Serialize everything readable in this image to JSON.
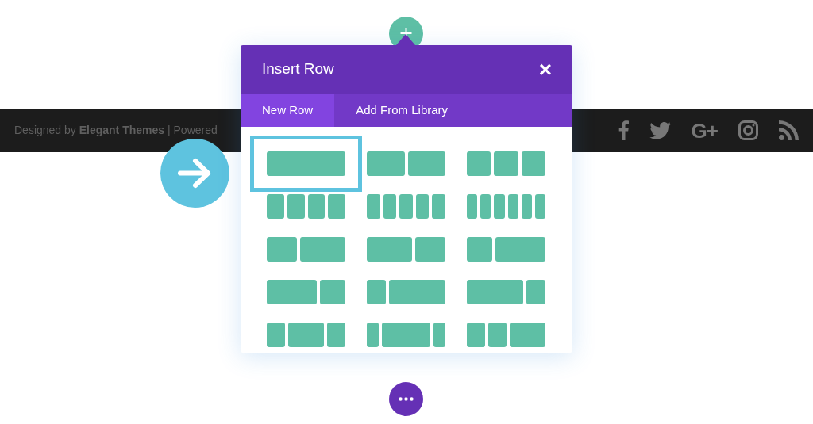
{
  "footer": {
    "credit": "Designed by **Elegant Themes** | Powered",
    "social": [
      {
        "kind": "facebook"
      },
      {
        "kind": "twitter"
      },
      {
        "kind": "gplus",
        "label": "G+"
      },
      {
        "kind": "instagram"
      },
      {
        "kind": "rss"
      }
    ]
  },
  "dialog": {
    "title": "Insert Row",
    "close": "×",
    "tabs": [
      {
        "label": "New Row",
        "selected": true
      },
      {
        "label": "Add From Library",
        "selected": false
      }
    ],
    "layouts": [
      {
        "kind": "full",
        "selected": true
      },
      {
        "kind": "halves",
        "selected": false
      },
      {
        "kind": "thirds",
        "selected": false
      },
      {
        "kind": "quarters",
        "selected": false
      },
      {
        "kind": "fifths",
        "selected": false
      },
      {
        "kind": "sixths",
        "selected": false
      },
      {
        "kind": "twofifths",
        "selected": false
      },
      {
        "kind": "threefifths",
        "selected": false
      },
      {
        "kind": "onethird",
        "selected": false
      },
      {
        "kind": "twothirds",
        "selected": false
      },
      {
        "kind": "onequarter",
        "selected": false
      },
      {
        "kind": "threequarters",
        "selected": false
      },
      {
        "kind": "centerhalf",
        "selected": false
      },
      {
        "kind": "centerwide",
        "selected": false
      },
      {
        "kind": "righthalf",
        "selected": false
      }
    ]
  }
}
